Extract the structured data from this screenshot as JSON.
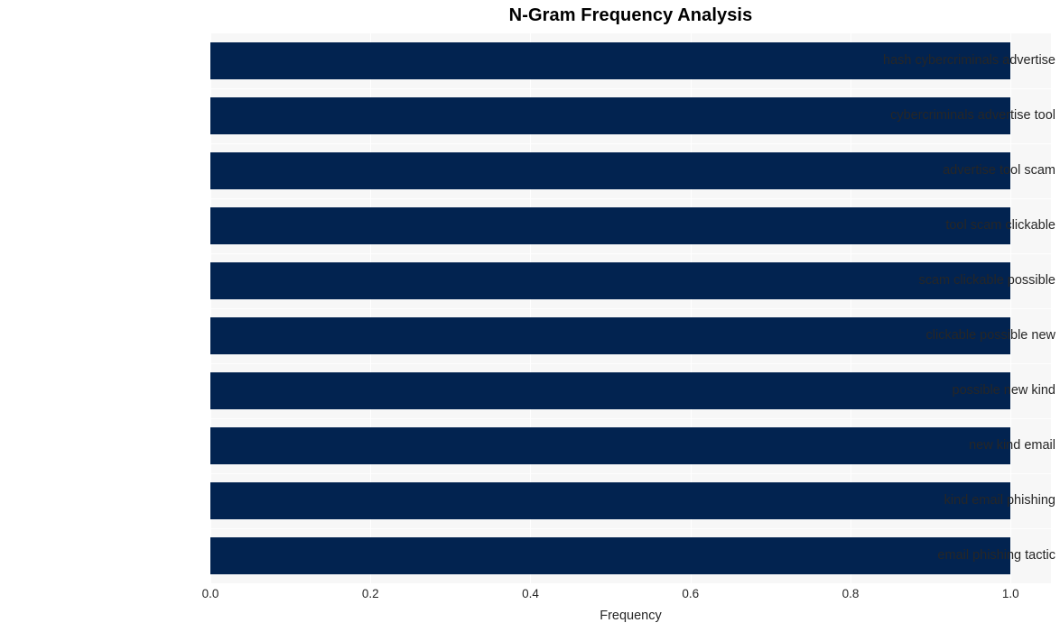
{
  "chart_data": {
    "type": "bar",
    "orientation": "horizontal",
    "title": "N-Gram Frequency Analysis",
    "xlabel": "Frequency",
    "ylabel": "",
    "categories": [
      "hash cybercriminals advertise",
      "cybercriminals advertise tool",
      "advertise tool scam",
      "tool scam clickable",
      "scam clickable possible",
      "clickable possible new",
      "possible new kind",
      "new kind email",
      "kind email phishing",
      "email phishing tactic"
    ],
    "values": [
      1.0,
      1.0,
      1.0,
      1.0,
      1.0,
      1.0,
      1.0,
      1.0,
      1.0,
      1.0
    ],
    "xticks": [
      "0.0",
      "0.2",
      "0.4",
      "0.6",
      "0.8",
      "1.0"
    ],
    "xtick_values": [
      0.0,
      0.2,
      0.4,
      0.6,
      0.8,
      1.0
    ],
    "xlim": [
      0.0,
      1.0505
    ],
    "grid": true,
    "legend": null,
    "bar_color": "#022350",
    "plot_background": "#f7f7f7",
    "gridline_color": "#ffffff",
    "figure_background": "#ffffff",
    "text_color": "#262626",
    "title_color": "#000000"
  }
}
